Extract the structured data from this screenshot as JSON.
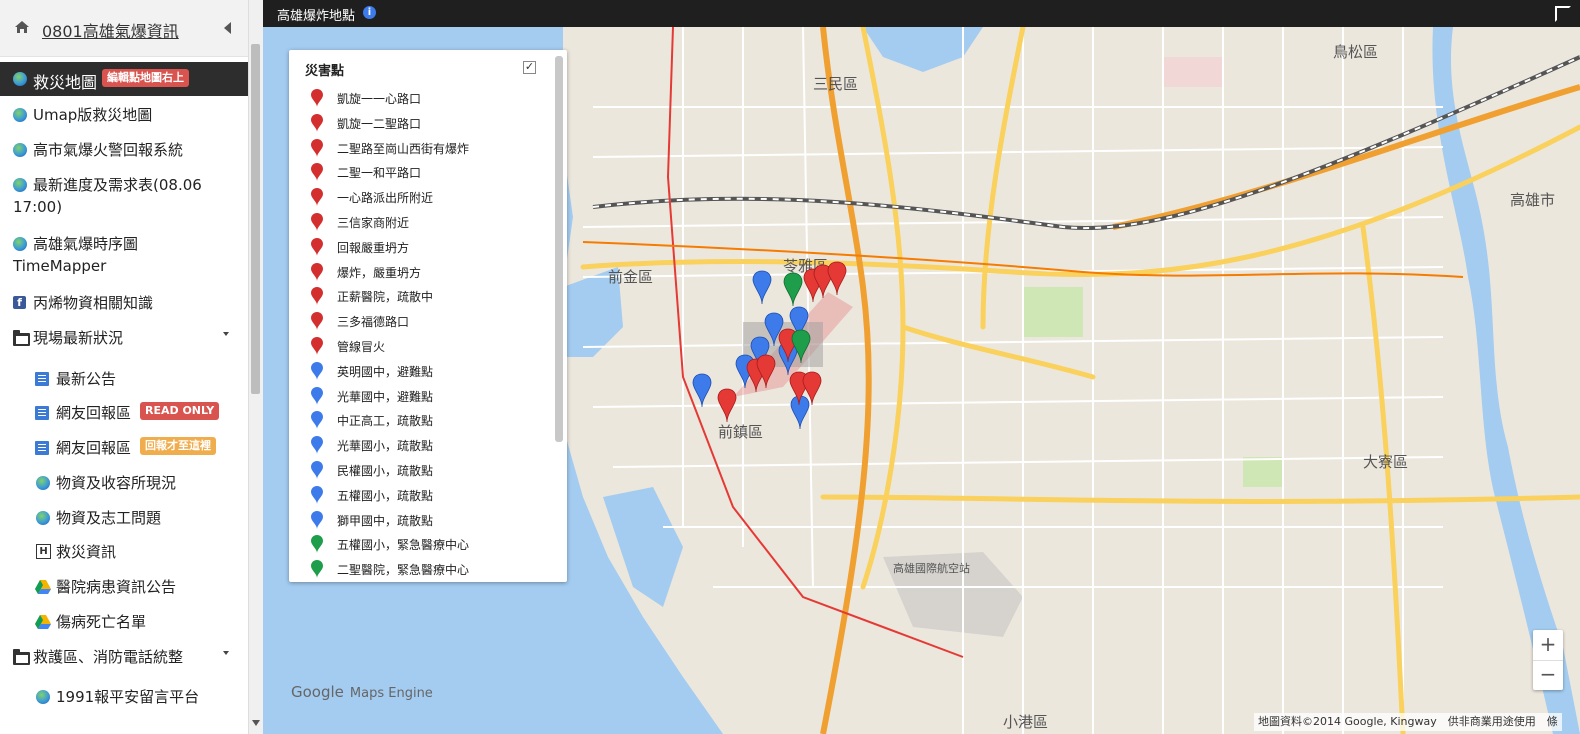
{
  "sidebar": {
    "title": "0801高雄氣爆資訊",
    "items": [
      {
        "label": "救災地圖",
        "badge": "編輯點地圖右上"
      },
      {
        "label": "Umap版救災地圖"
      },
      {
        "label": "高市氣爆火警回報系統"
      },
      {
        "label": "最新進度及需求表(08.06",
        "label2": "17:00)"
      },
      {
        "label": "高雄氣爆時序圖",
        "label2": "TimeMapper"
      },
      {
        "label": "丙烯物資相關知識"
      },
      {
        "label": "現場最新狀況"
      },
      {
        "label": "最新公告"
      },
      {
        "label": "網友回報區",
        "badge": "READ ONLY"
      },
      {
        "label": "網友回報區",
        "badge": "回報才至這裡"
      },
      {
        "label": "物資及收容所現況"
      },
      {
        "label": "物資及志工問題"
      },
      {
        "label": "救災資訊"
      },
      {
        "label": "醫院病患資訊公告"
      },
      {
        "label": "傷病死亡名單"
      },
      {
        "label": "救護區、消防電話統整"
      },
      {
        "label": "1991報平安留言平台"
      }
    ]
  },
  "map": {
    "title": "高雄爆炸地點",
    "google_logo": "Google",
    "maps_engine": "Maps Engine",
    "attribution": "地圖資料©2014 Google, Kingway　供非商業用途使用　條",
    "zoom_in": "+",
    "zoom_out": "−",
    "districts": [
      "三民區",
      "苓雅區",
      "前金區",
      "前鎮區",
      "高雄市",
      "大寮區",
      "鳥松區",
      "小港區",
      "高雄國際航空站"
    ]
  },
  "legend": {
    "title": "災害點",
    "check": "✓",
    "items": [
      {
        "label": "凱旋一一心路口",
        "color": "#d32f2f"
      },
      {
        "label": "凱旋一二聖路口",
        "color": "#d32f2f"
      },
      {
        "label": "二聖路至崗山西街有爆炸",
        "color": "#d32f2f"
      },
      {
        "label": "二聖一和平路口",
        "color": "#d32f2f"
      },
      {
        "label": "一心路派出所附近",
        "color": "#d32f2f"
      },
      {
        "label": "三信家商附近",
        "color": "#d32f2f"
      },
      {
        "label": "回報嚴重坍方",
        "color": "#d32f2f"
      },
      {
        "label": "爆炸，嚴重坍方",
        "color": "#d32f2f"
      },
      {
        "label": "正薪醫院，疏散中",
        "color": "#d32f2f"
      },
      {
        "label": "三多福德路口",
        "color": "#d32f2f"
      },
      {
        "label": "管線冒火",
        "color": "#d32f2f"
      },
      {
        "label": "英明國中，避難點",
        "color": "#3d7bea"
      },
      {
        "label": "光華國中，避難點",
        "color": "#3d7bea"
      },
      {
        "label": "中正高工，疏散點",
        "color": "#3d7bea"
      },
      {
        "label": "光華國小，疏散點",
        "color": "#3d7bea"
      },
      {
        "label": "民權國小，疏散點",
        "color": "#3d7bea"
      },
      {
        "label": "五權國小，疏散點",
        "color": "#3d7bea"
      },
      {
        "label": "獅甲國中，疏散點",
        "color": "#3d7bea"
      },
      {
        "label": "五權國小，緊急醫療中心",
        "color": "#1e9e4a"
      },
      {
        "label": "二聖醫院，緊急醫療中心",
        "color": "#1e9e4a"
      }
    ]
  }
}
